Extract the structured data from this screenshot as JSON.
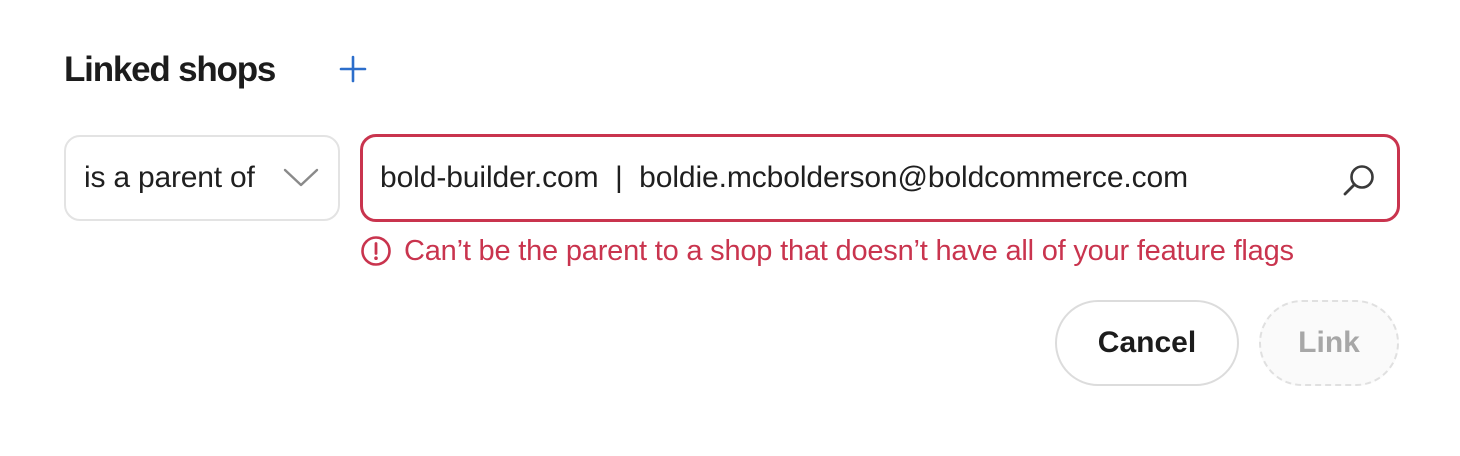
{
  "section": {
    "title": "Linked shops",
    "add_icon": "plus-icon"
  },
  "relation": {
    "selected": "is a parent of",
    "icon": "chevron-down-icon"
  },
  "search": {
    "value": "bold-builder.com  |  boldie.mcbolderson@boldcommerce.com",
    "icon": "search-icon"
  },
  "error": {
    "icon": "exclamation-circle-icon",
    "message": "Can’t be the parent to a shop that doesn’t have all of your feature flags"
  },
  "actions": {
    "cancel_label": "Cancel",
    "link_label": "Link",
    "link_disabled": true
  },
  "colors": {
    "accent": "#2c6ecb",
    "critical": "#c9344e",
    "text": "#1c1c1c",
    "disabled_text": "#a7a7a7"
  }
}
